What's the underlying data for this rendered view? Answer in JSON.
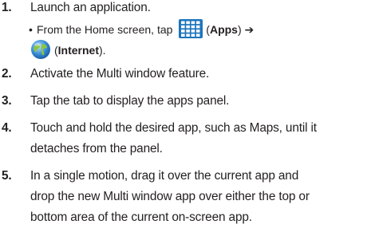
{
  "steps": [
    {
      "num": "1.",
      "text": "Launch an application."
    },
    {
      "num": "2.",
      "text": "Activate the Multi window feature."
    },
    {
      "num": "3.",
      "text": "Tap the tab to display the apps panel."
    },
    {
      "num": "4.",
      "lines": [
        "Touch and hold the desired app, such as Maps, until it",
        "detaches from the panel."
      ]
    },
    {
      "num": "5.",
      "lines": [
        "In a single motion, drag it over the current app and",
        "drop the new Multi window app over either the top or",
        "bottom area of the current on-screen app."
      ]
    }
  ],
  "substep": {
    "bullet": "•",
    "prefix": "From the Home screen, tap",
    "apps_paren_open": "(",
    "apps_label": "Apps",
    "apps_paren_close": ")",
    "arrow": "➔",
    "internet_paren_open": "(",
    "internet_label": "Internet",
    "internet_paren_close": ").",
    "apps_icon": "apps-grid-icon",
    "internet_icon": "internet-globe-icon"
  },
  "colors": {
    "text": "#231f20",
    "apps_icon_bg": "#1c75bc",
    "globe_blue": "#3a8fd6",
    "globe_green": "#8cc63f"
  }
}
